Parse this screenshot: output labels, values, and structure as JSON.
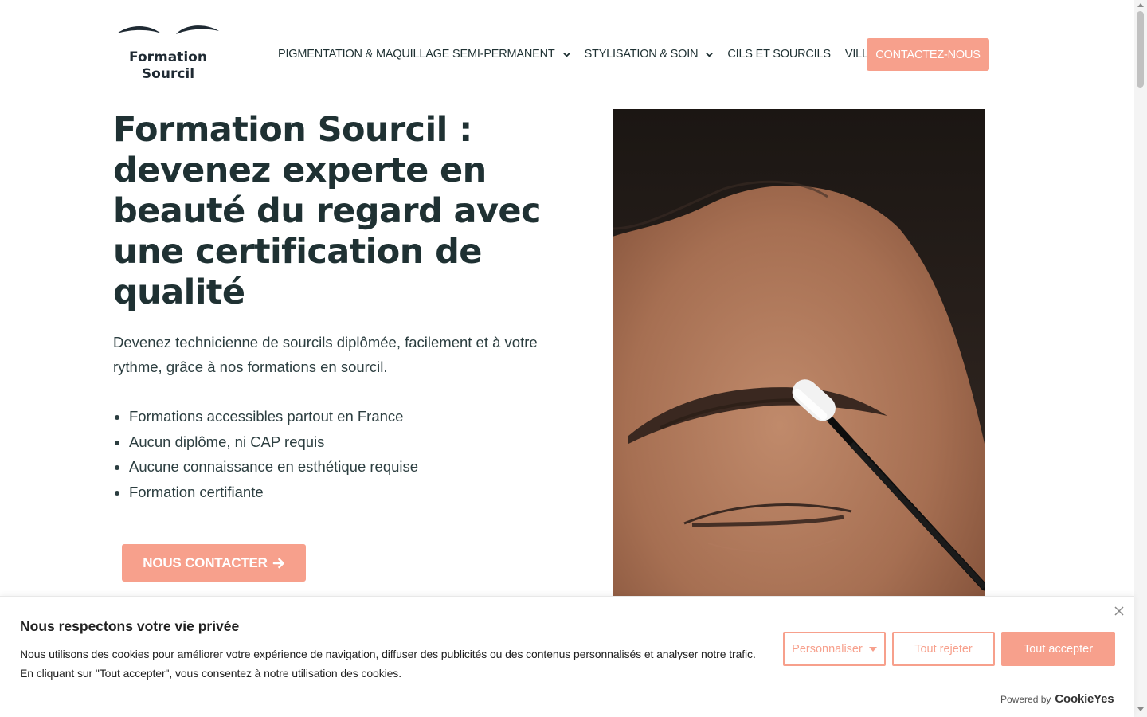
{
  "brand": {
    "logo_line1": "Formation",
    "logo_line2": "Sourcil",
    "logo_icon": "eyebrows-icon"
  },
  "nav": {
    "items": [
      {
        "label": "PIGMENTATION & MAQUILLAGE SEMI-PERMANENT",
        "has_dropdown": true
      },
      {
        "label": "STYLISATION & SOIN",
        "has_dropdown": true
      },
      {
        "label": "CILS ET SOURCILS",
        "has_dropdown": false
      },
      {
        "label": "VILLES",
        "has_dropdown": false
      }
    ],
    "cta_label": "CONTACTEZ-NOUS"
  },
  "hero": {
    "title": "Formation Sourcil : devenez experte en beauté du regard avec une certification de qualité",
    "subtitle": "Devenez technicienne de sourcils diplômée, facilement et à votre rythme, grâce à nos formations en sourcil.",
    "bullets": [
      "Formations accessibles partout en France",
      "Aucun diplôme, ni CAP requis",
      "Aucune connaissance en esthétique requise",
      "Formation certifiante"
    ],
    "button_label": "NOUS CONTACTER",
    "button_icon": "arrow-right-icon"
  },
  "cookie": {
    "title": "Nous respectons votre vie privée",
    "text": "Nous utilisons des cookies pour améliorer votre expérience de navigation, diffuser des publicités ou des contenus personnalisés et analyser notre trafic. En cliquant sur \"Tout accepter\", vous consentez à notre utilisation des cookies.",
    "customize_label": "Personnaliser",
    "reject_label": "Tout rejeter",
    "accept_label": "Tout accepter",
    "powered_by": "Powered by",
    "powered_brand": "CookieYes"
  },
  "colors": {
    "accent": "#f7a08c",
    "heading": "#1f3133",
    "text": "#2c3e40"
  }
}
